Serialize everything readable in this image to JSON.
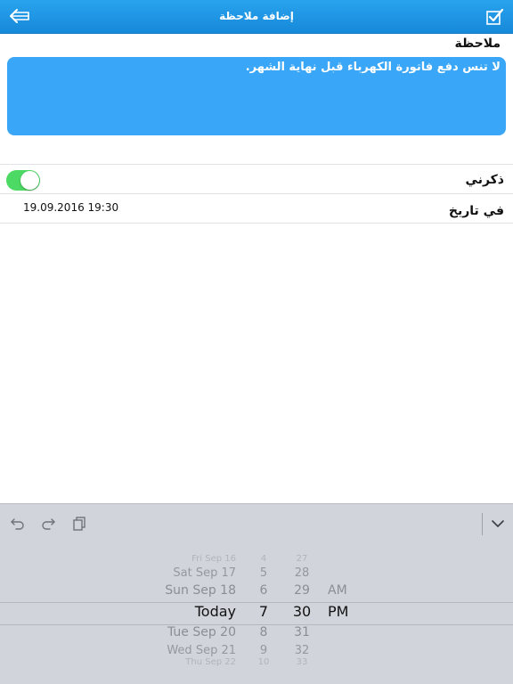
{
  "navbar": {
    "title": "إضافة ملاحظة",
    "back_icon": "back-arrow-icon",
    "save_icon": "checkbox-check-icon",
    "color": "#1a8fde"
  },
  "note": {
    "label": "ملاحظة",
    "text": "لا تنس دفع فاتورة الكهرباء قبل نهاية الشهر.",
    "box_color": "#3aa6f7"
  },
  "remind": {
    "label": "ذكرني",
    "enabled": true,
    "toggle_color": "#4cd964"
  },
  "date": {
    "label": "في تاريخ",
    "value": "19.09.2016 19:30"
  },
  "toolbar": {
    "undo_icon": "undo-icon",
    "redo_icon": "redo-icon",
    "paste_icon": "paste-icon",
    "dismiss_icon": "chevron-down-icon"
  },
  "picker": {
    "dates": [
      "Fri Sep 16",
      "Sat Sep 17",
      "Sun Sep 18",
      "Today",
      "Tue Sep 20",
      "Wed Sep 21",
      "Thu Sep 22"
    ],
    "hours": [
      "4",
      "5",
      "6",
      "7",
      "8",
      "9",
      "10"
    ],
    "minutes": [
      "27",
      "28",
      "29",
      "30",
      "31",
      "32",
      "33"
    ],
    "ampm": [
      "AM",
      "PM"
    ],
    "selected": {
      "date": "Today",
      "hour": "7",
      "minute": "30",
      "ampm": "PM"
    }
  }
}
